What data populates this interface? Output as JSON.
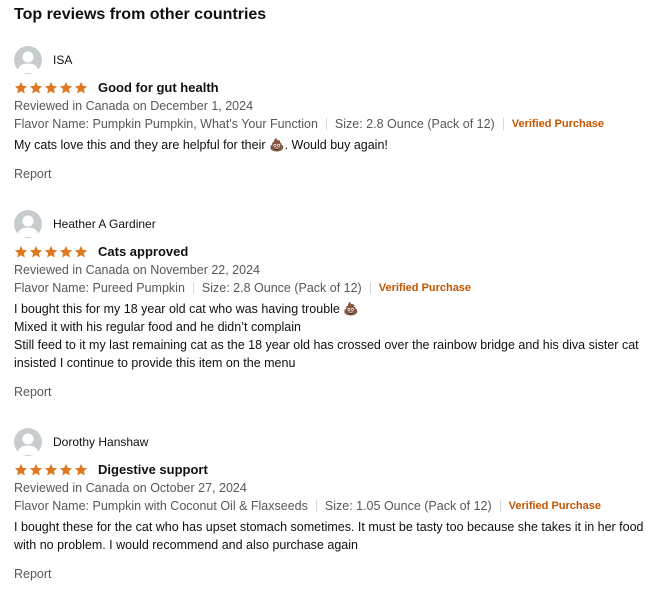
{
  "section_title": "Top reviews from other countries",
  "colors": {
    "star": "#de7921",
    "verified": "#c45500",
    "avatar_bg": "#c7cccf"
  },
  "reviews": [
    {
      "author": "ISA",
      "rating": 5,
      "title": "Good for gut health",
      "date": "Reviewed in Canada on December 1, 2024",
      "flavor": "Flavor Name: Pumpkin Pumpkin, What's Your Function",
      "size": "Size: 2.8 Ounce (Pack of 12)",
      "verified": "Verified Purchase",
      "body_before": "My cats love this and they are helpful for their ",
      "body_emoji": "💩",
      "body_after": ". Would buy again!",
      "report": "Report"
    },
    {
      "author": "Heather A Gardiner",
      "rating": 5,
      "title": "Cats approved",
      "date": "Reviewed in Canada on November 22, 2024",
      "flavor": "Flavor Name: Pureed Pumpkin",
      "size": "Size: 2.8 Ounce (Pack of 12)",
      "verified": "Verified Purchase",
      "body_line1": "I bought this for my 18 year old cat who was having trouble ",
      "body_emoji": "💩",
      "body_line2": "Mixed it with his regular food and he didn’t complain",
      "body_line3": "Still feed to it my last remaining cat as the 18 year old has crossed over the rainbow bridge and his diva sister cat insisted I continue to provide this item on the menu",
      "report": "Report"
    },
    {
      "author": "Dorothy Hanshaw",
      "rating": 5,
      "title": "Digestive support",
      "date": "Reviewed in Canada on October 27, 2024",
      "flavor": "Flavor Name: Pumpkin with Coconut Oil & Flaxseeds",
      "size": "Size: 1.05 Ounce (Pack of 12)",
      "verified": "Verified Purchase",
      "body": "I bought these for the cat who has upset stomach sometimes. It must be tasty too because she takes it in her food with no problem. I would recommend and also purchase again",
      "report": "Report"
    }
  ]
}
